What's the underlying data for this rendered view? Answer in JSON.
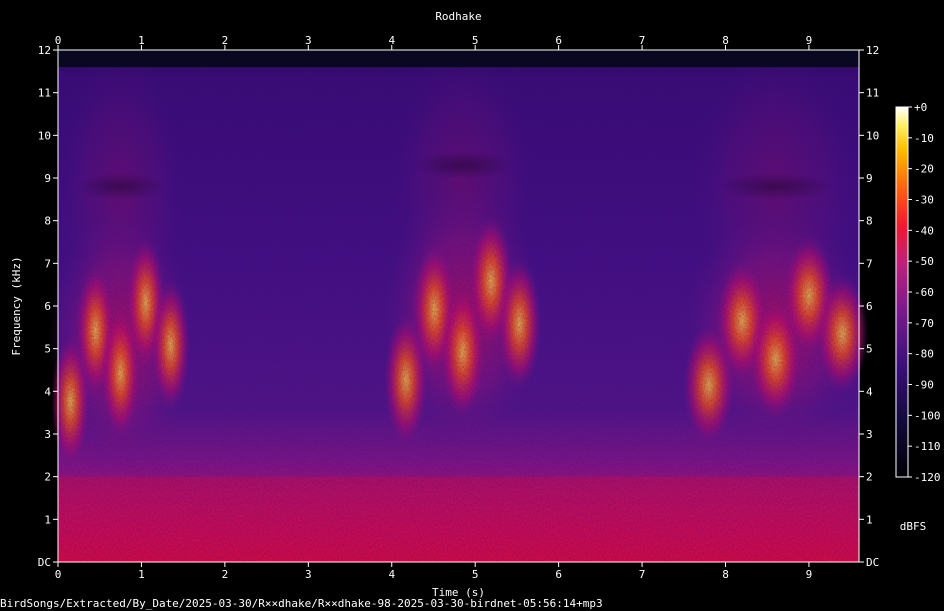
{
  "chart_data": {
    "type": "heatmap",
    "title": "Rodhake",
    "xlabel": "Time (s)",
    "ylabel": "Frequency (kHz)",
    "x_ticks": [
      "0",
      "1",
      "2",
      "3",
      "4",
      "5",
      "6",
      "7",
      "8",
      "9"
    ],
    "y_ticks": [
      "DC",
      "1",
      "2",
      "3",
      "4",
      "5",
      "6",
      "7",
      "8",
      "9",
      "10",
      "11",
      "12"
    ],
    "xlim": [
      0,
      9.6
    ],
    "ylim": [
      0,
      12
    ],
    "colorbar": {
      "label": "dBFS",
      "range": [
        -120,
        0
      ],
      "ticks": [
        "+0",
        "-10",
        "-20",
        "-30",
        "-40",
        "-50",
        "-60",
        "-70",
        "-80",
        "-90",
        "-100",
        "-110",
        "-120"
      ]
    },
    "energy_regions": [
      {
        "t_start": 0.0,
        "t_end": 1.5,
        "f_low": 2.5,
        "f_high": 8.0,
        "peak_dbfs": -30
      },
      {
        "t_start": 4.0,
        "t_end": 5.7,
        "f_low": 3.0,
        "f_high": 8.5,
        "peak_dbfs": -25
      },
      {
        "t_start": 7.6,
        "t_end": 9.6,
        "f_low": 3.0,
        "f_high": 8.0,
        "peak_dbfs": -30
      }
    ],
    "low_frequency_band": {
      "f_low": 0.0,
      "f_high": 2.0,
      "level_dbfs": -60
    }
  },
  "footer": {
    "file_path": "BirdSongs/Extracted/By_Date/2025-03-30/R××dhake/R××dhake-98-2025-03-30-birdnet-05:56:14+mp3"
  }
}
